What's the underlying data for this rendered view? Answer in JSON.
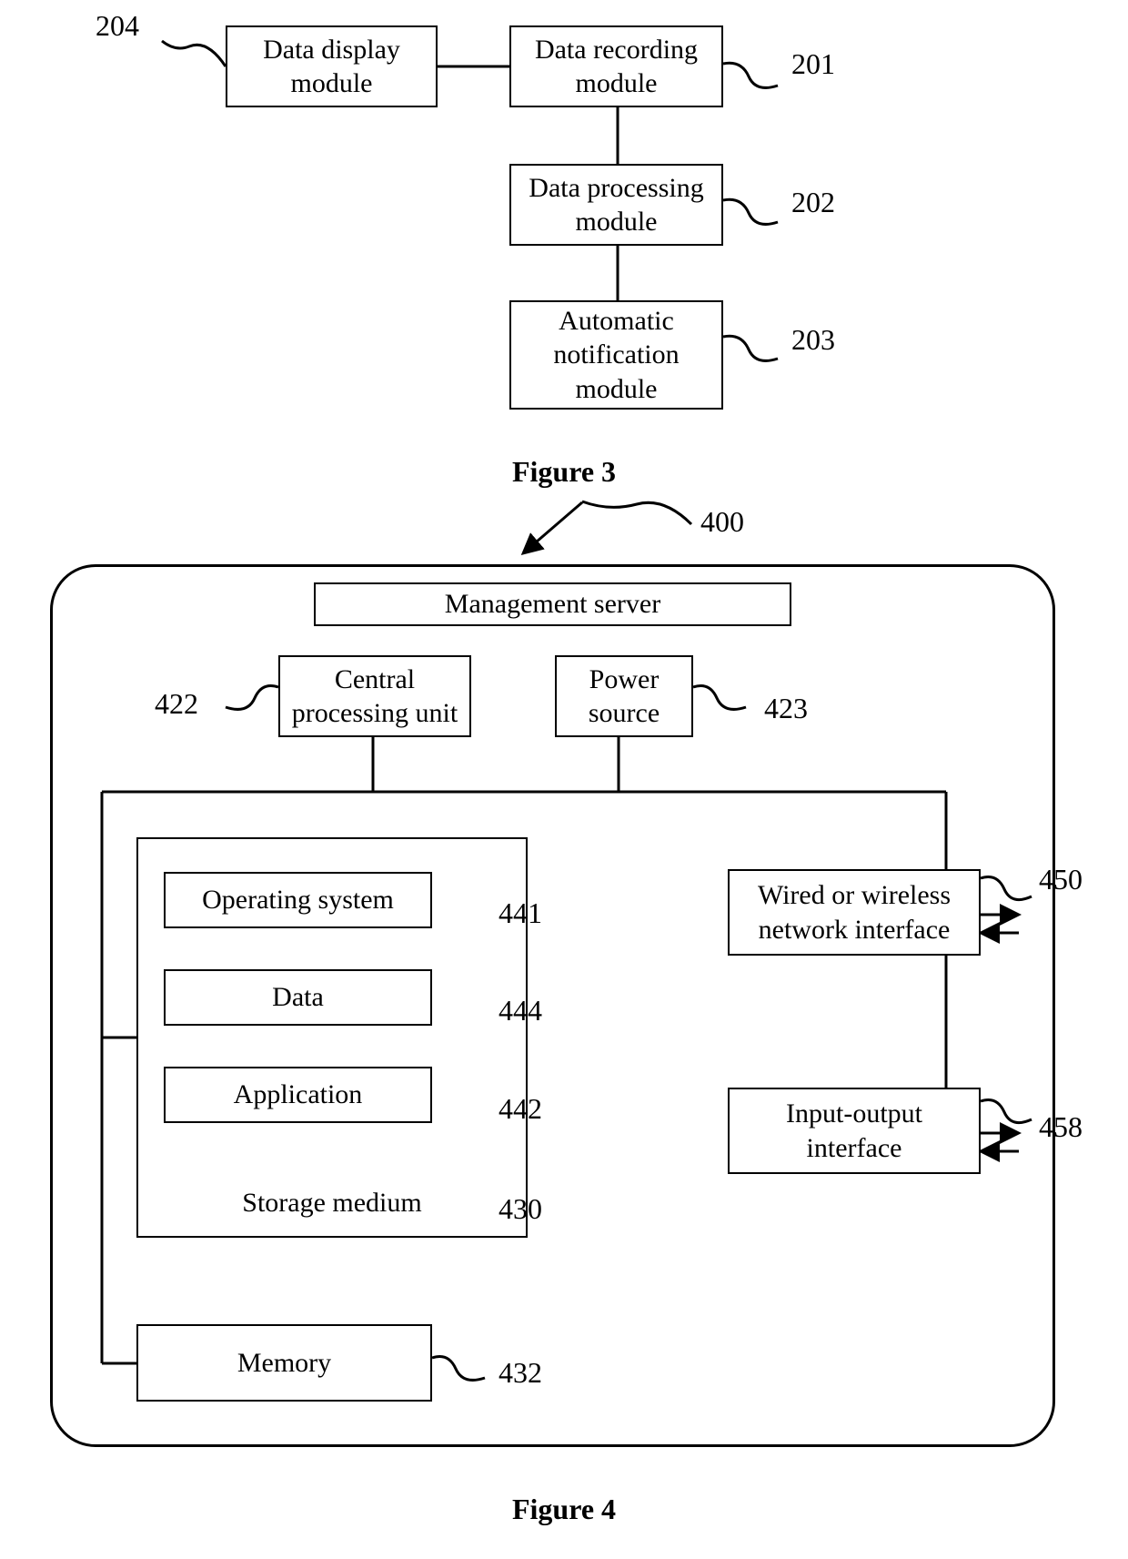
{
  "figure3": {
    "caption": "Figure 3",
    "boxes": {
      "data_display": {
        "label": "Data display module",
        "ref": "204"
      },
      "data_recording": {
        "label": "Data recording module",
        "ref": "201"
      },
      "data_processing": {
        "label": "Data processing module",
        "ref": "202"
      },
      "auto_notification": {
        "label": "Automatic notification module",
        "ref": "203"
      }
    }
  },
  "figure4": {
    "caption": "Figure 4",
    "container_ref": "400",
    "boxes": {
      "management_server": {
        "label": "Management server"
      },
      "cpu": {
        "label": "Central processing unit",
        "ref": "422"
      },
      "power": {
        "label": "Power source",
        "ref": "423"
      },
      "os": {
        "label": "Operating system",
        "ref": "441"
      },
      "data": {
        "label": "Data",
        "ref": "444"
      },
      "application": {
        "label": "Application",
        "ref": "442"
      },
      "storage_medium": {
        "label": "Storage medium",
        "ref": "430"
      },
      "memory": {
        "label": "Memory",
        "ref": "432"
      },
      "network_iface": {
        "label": "Wired or wireless network interface",
        "ref": "450"
      },
      "io_iface": {
        "label": "Input-output interface",
        "ref": "458"
      }
    }
  }
}
